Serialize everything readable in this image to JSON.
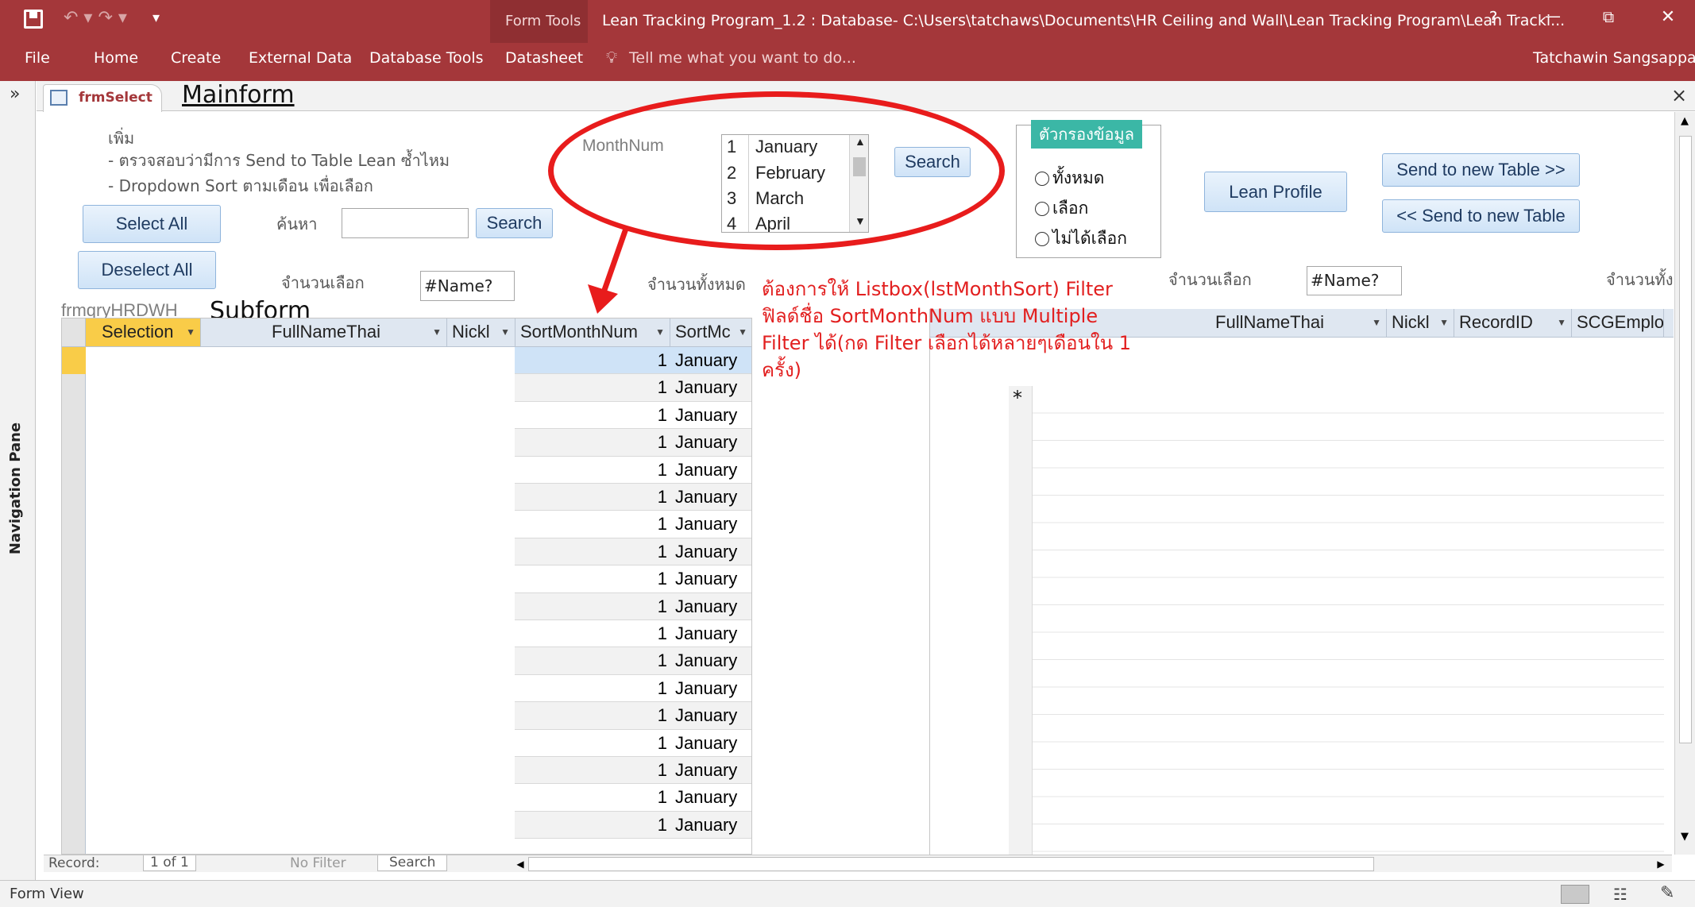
{
  "titlebar": {
    "form_tools": "Form Tools",
    "title": "Lean Tracking Program_1.2 : Database- C:\\Users\\tatchaws\\Documents\\HR Ceiling and Wall\\Lean Tracking Program\\Lean Tracki...",
    "help": "?",
    "minimize": "—",
    "restore": "⧉",
    "close": "✕"
  },
  "ribbon": {
    "tabs": [
      "File",
      "Home",
      "Create",
      "External Data",
      "Database Tools",
      "Datasheet"
    ],
    "tell_me": "Tell me what you want to do...",
    "user": "Tatchawin Sangsappan"
  },
  "nav": {
    "toggle": "»",
    "label": "Navigation Pane"
  },
  "doc_tab": {
    "name": "frmSelect",
    "close": "×"
  },
  "annotations": {
    "mainform": "Mainform",
    "subform": "Subform",
    "note": [
      "ต้องการให้ Listbox(lstMonthSort) Filter",
      "ฟิลด์ชื่อ SortMonthNum แบบ Multiple",
      "Filter ได้(กด Filter เลือกได้หลายๆเดือนใน 1",
      "ครั้ง)"
    ]
  },
  "form": {
    "notes": [
      "เพิ่ม",
      "- ตรวจสอบว่ามีการ Send to Table Lean ซ้ำไหม",
      "- Dropdown Sort ตามเดือน เพื่อเลือก"
    ],
    "select_all": "Select All",
    "deselect_all": "Deselect All",
    "search_label": "ค้นหา",
    "search_button": "Search",
    "selected_count_label": "จำนวนเลือก",
    "selected_count_value": "#Name?",
    "total_label": "จำนวนทั้งหมด",
    "month_label": "MonthNum",
    "month_list": [
      {
        "num": "1",
        "name": "January"
      },
      {
        "num": "2",
        "name": "February"
      },
      {
        "num": "3",
        "name": "March"
      },
      {
        "num": "4",
        "name": "April"
      }
    ],
    "month_search": "Search",
    "filter_group": {
      "title": "ตัวกรองข้อมูล",
      "options": [
        "ทั้งหมด",
        "เลือก",
        "ไม่ได้เลือก"
      ]
    },
    "lean_profile": "Lean Profile",
    "send_to": "Send to new Table >>",
    "send_back": "<< Send to new Table",
    "right_selected_label": "จำนวนเลือก",
    "right_selected_value": "#Name?",
    "right_total_label": "จำนวนทั้ง"
  },
  "subform": {
    "name": "frmqryHRDWH",
    "headers": [
      "Selection",
      "FullNameThai",
      "Nickl",
      "SortMonthNum",
      "SortMc"
    ],
    "rows": [
      {
        "num": "1",
        "month": "January"
      },
      {
        "num": "1",
        "month": "January"
      },
      {
        "num": "1",
        "month": "January"
      },
      {
        "num": "1",
        "month": "January"
      },
      {
        "num": "1",
        "month": "January"
      },
      {
        "num": "1",
        "month": "January"
      },
      {
        "num": "1",
        "month": "January"
      },
      {
        "num": "1",
        "month": "January"
      },
      {
        "num": "1",
        "month": "January"
      },
      {
        "num": "1",
        "month": "January"
      },
      {
        "num": "1",
        "month": "January"
      },
      {
        "num": "1",
        "month": "January"
      },
      {
        "num": "1",
        "month": "January"
      },
      {
        "num": "1",
        "month": "January"
      },
      {
        "num": "1",
        "month": "January"
      },
      {
        "num": "1",
        "month": "January"
      },
      {
        "num": "1",
        "month": "January"
      },
      {
        "num": "1",
        "month": "January"
      }
    ],
    "record_label": "Record:",
    "record_pos": "1 of 1",
    "no_filter": "No Filter",
    "search": "Search"
  },
  "right_grid": {
    "headers": [
      "FullNameThai",
      "Nickl",
      "RecordID",
      "SCGEmploy"
    ],
    "new_row_marker": "*"
  },
  "status": {
    "view": "Form View"
  },
  "colors": {
    "accent": "#a4373a",
    "annotation": "#e21f1f",
    "teal": "#3bb7a6"
  }
}
